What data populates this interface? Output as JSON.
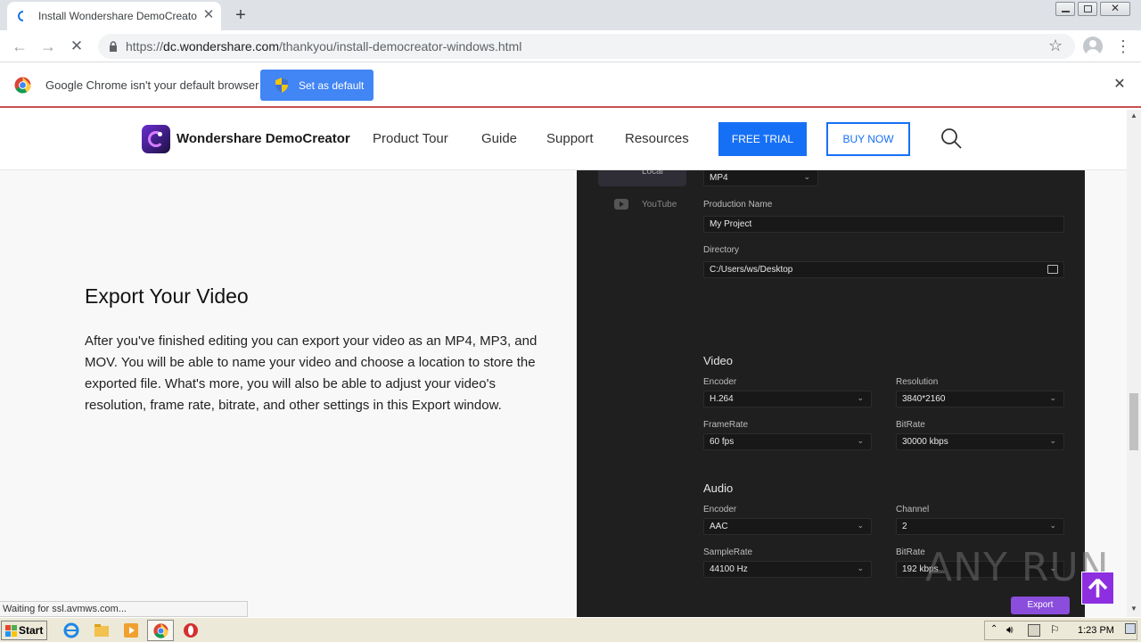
{
  "browser": {
    "tab_title": "Install Wondershare DemoCreator S",
    "url_scheme": "https://",
    "url_host": "dc.wondershare.com",
    "url_path": "/thankyou/install-democreator-windows.html",
    "infobar_text": "Google Chrome isn't your default browser",
    "set_default_label": "Set as default",
    "status_text": "Waiting for ssl.avmws.com..."
  },
  "site": {
    "brand": "Wondershare DemoCreator",
    "nav": [
      "Product Tour",
      "Guide",
      "Support",
      "Resources"
    ],
    "free_trial": "FREE TRIAL",
    "buy_now": "BUY NOW"
  },
  "content": {
    "title": "Export Your Video",
    "body": "After you've finished editing you can export your video as an MP4, MP3, and MOV. You will be able to name your video and choose a location to store the exported file. What's more, you will also be able to adjust your video's resolution, frame rate, bitrate, and other settings in this Export window."
  },
  "export_window": {
    "side_local": "Local",
    "side_youtube": "YouTube",
    "format_value": "MP4",
    "production_name_label": "Production Name",
    "production_name_value": "My Project",
    "directory_label": "Directory",
    "directory_value": "C:/Users/ws/Desktop",
    "video_heading": "Video",
    "video_encoder_label": "Encoder",
    "video_encoder_value": "H.264",
    "resolution_label": "Resolution",
    "resolution_value": "3840*2160",
    "framerate_label": "FrameRate",
    "framerate_value": "60 fps",
    "video_bitrate_label": "BitRate",
    "video_bitrate_value": "30000 kbps",
    "audio_heading": "Audio",
    "audio_encoder_label": "Encoder",
    "audio_encoder_value": "AAC",
    "channel_label": "Channel",
    "channel_value": "2",
    "samplerate_label": "SampleRate",
    "samplerate_value": "44100 Hz",
    "audio_bitrate_label": "BitRate",
    "audio_bitrate_value": "192 kbps",
    "export_label": "Export"
  },
  "watermark": "ANY RUN",
  "taskbar": {
    "start_label": "Start",
    "clock": "1:23 PM"
  },
  "colors": {
    "accent_blue": "#1670f5",
    "chrome_blue": "#4285f4",
    "purple": "#8d2fe0"
  }
}
